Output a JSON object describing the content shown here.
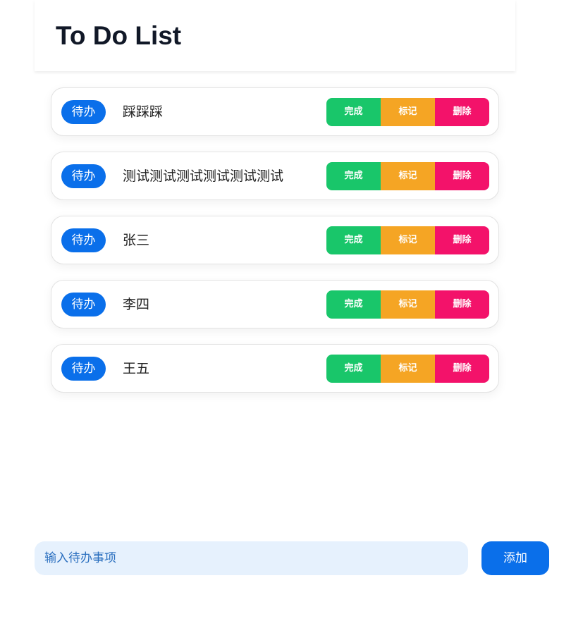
{
  "header": {
    "title": "To Do List"
  },
  "actions": {
    "done_label": "完成",
    "mark_label": "标记",
    "delete_label": "删除"
  },
  "items": [
    {
      "status": "待办",
      "text": "踩踩踩"
    },
    {
      "status": "待办",
      "text": "测试测试测试测试测试测试"
    },
    {
      "status": "待办",
      "text": "张三"
    },
    {
      "status": "待办",
      "text": "李四"
    },
    {
      "status": "待办",
      "text": "王五"
    }
  ],
  "composer": {
    "placeholder": "输入待办事项",
    "value": "",
    "add_label": "添加"
  },
  "colors": {
    "primary": "#0a6fea",
    "done": "#19c66a",
    "mark": "#f5a524",
    "delete": "#f3126a",
    "input_bg": "#e6f1fd"
  }
}
